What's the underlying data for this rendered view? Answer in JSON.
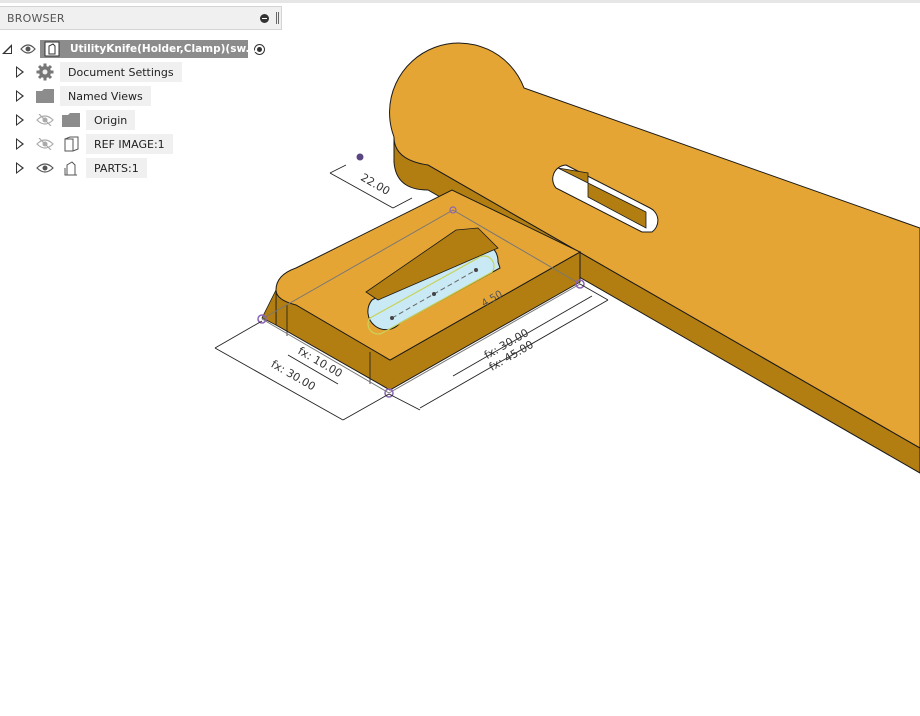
{
  "browser": {
    "title": "BROWSER",
    "root": {
      "label": "UtilityKnife(Holder,Clamp)(sw..."
    },
    "items": [
      {
        "label": "Document Settings"
      },
      {
        "label": "Named Views"
      },
      {
        "label": "Origin"
      },
      {
        "label": "REF IMAGE:1"
      },
      {
        "label": "PARTS:1"
      }
    ]
  },
  "sketch": {
    "dim_offset": "22.00",
    "dim_slot_width": "4.50",
    "dim_slot_length": "fx: 30.00",
    "dim_length": "fx: 45.00",
    "dim_edge": "fx: 10.00",
    "dim_width": "fx: 30.00"
  },
  "colors": {
    "part_top": "#E5A534",
    "part_side": "#B07C11",
    "slot_face": "#C9E9F5",
    "sketch_point": "#8A63B8"
  }
}
